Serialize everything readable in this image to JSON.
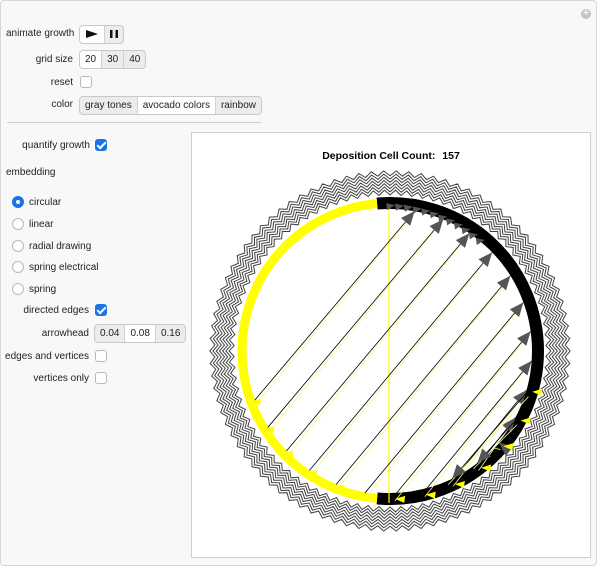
{
  "controls": {
    "animate_label": "animate growth",
    "play_icon": "play-icon",
    "pause_icon": "pause-icon",
    "grid_label": "grid size",
    "grid_options": [
      "20",
      "30",
      "40"
    ],
    "grid_selected": "20",
    "reset_label": "reset",
    "color_label": "color",
    "color_options": [
      "gray tones",
      "avocado colors",
      "rainbow"
    ],
    "color_selected": "avocado colors",
    "quantify_label": "quantify growth",
    "quantify_checked": true,
    "embedding_label": "embedding",
    "embedding_options": [
      "circular",
      "linear",
      "radial drawing",
      "spring electrical",
      "spring"
    ],
    "embedding_selected": "circular",
    "directed_label": "directed edges",
    "directed_checked": true,
    "arrowhead_label": "arrowhead",
    "arrowhead_options": [
      "0.04",
      "0.08",
      "0.16"
    ],
    "arrowhead_selected": "0.08",
    "edges_vertices_label": "edges and vertices",
    "edges_vertices_checked": false,
    "vertices_only_label": "vertices only",
    "vertices_only_checked": false
  },
  "plot": {
    "title_prefix": "Deposition Cell Count:",
    "count": "157",
    "colors": {
      "dark": "#000000",
      "highlight": "#ffff00",
      "arrow": "#555555",
      "light_edge": "#f7f78a"
    }
  },
  "accent": "#1a73e8"
}
